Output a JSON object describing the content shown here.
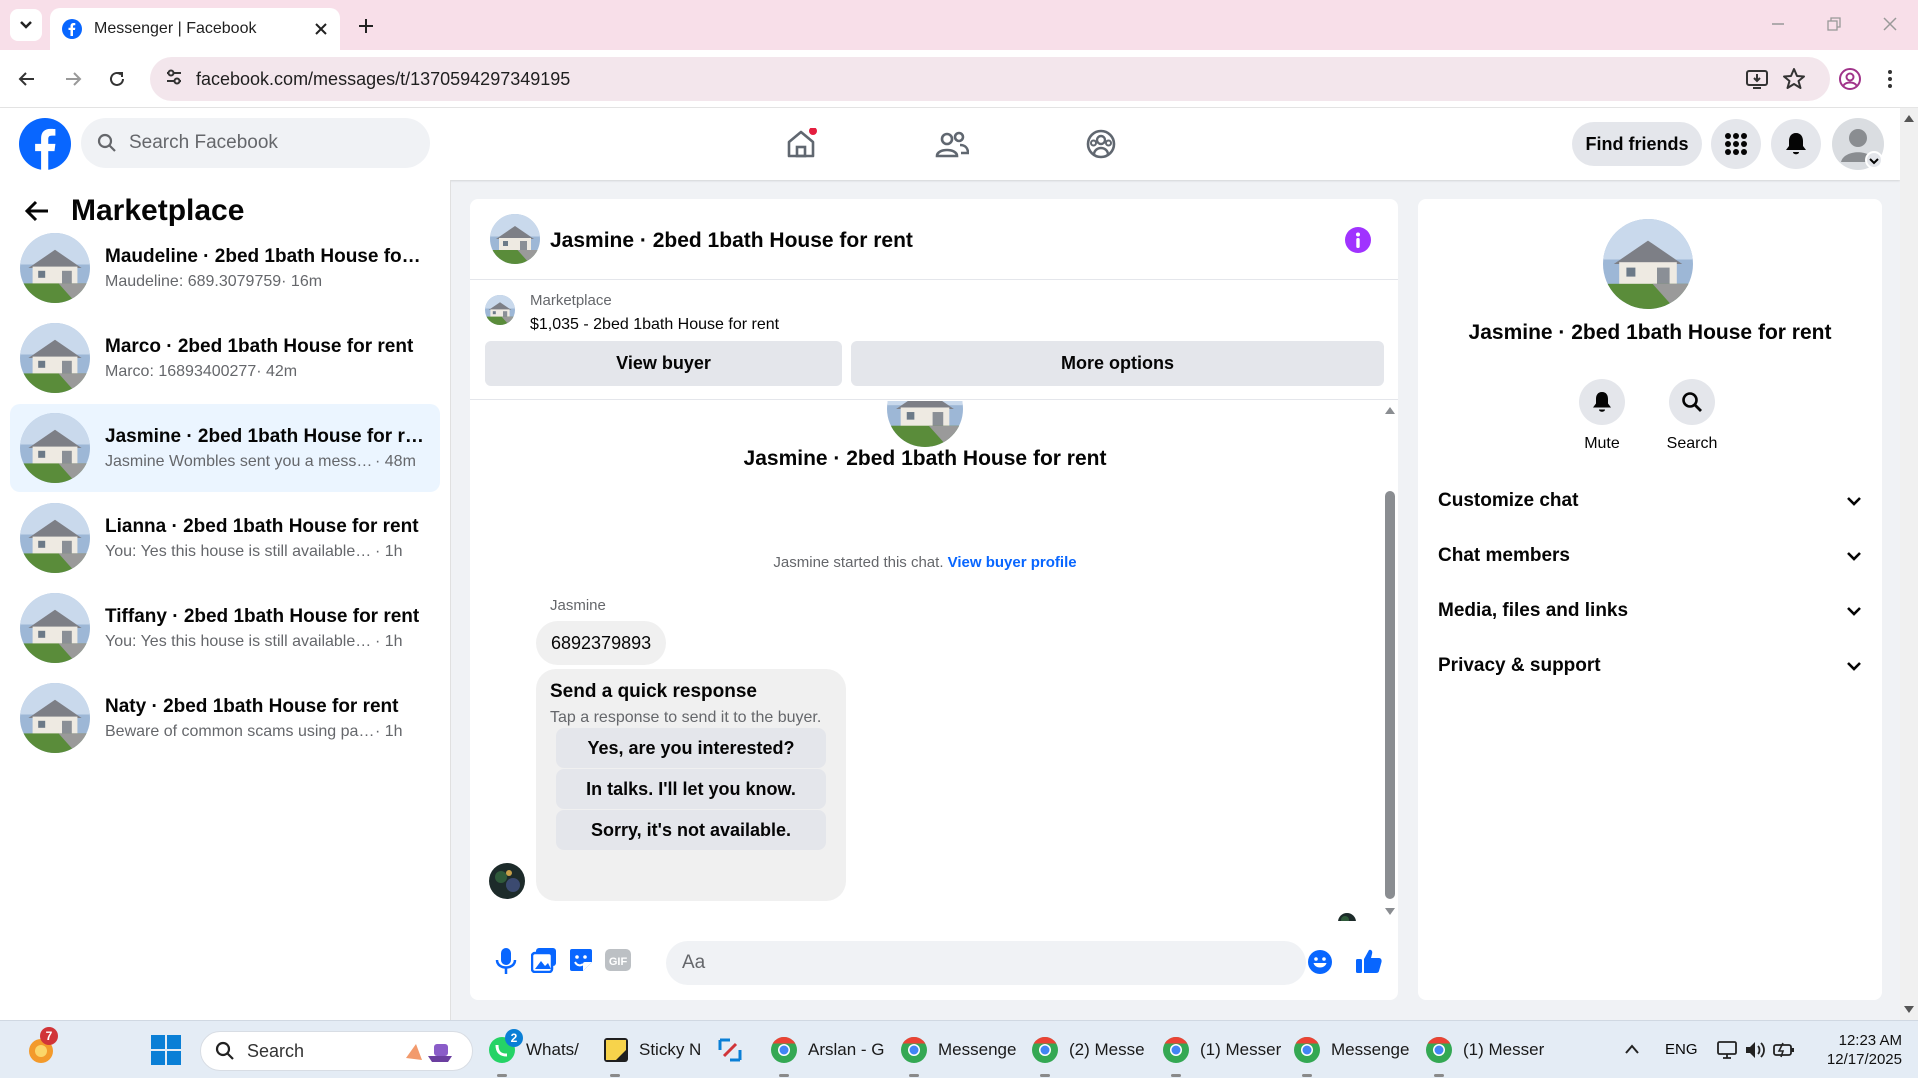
{
  "browser": {
    "tab_title": "Messenger | Facebook",
    "url": "facebook.com/messages/t/1370594297349195"
  },
  "header": {
    "search_placeholder": "Search Facebook",
    "find_friends": "Find friends"
  },
  "marketplace": {
    "title": "Marketplace",
    "conversations": [
      {
        "title": "Maudeline · 2bed 1bath House for ...",
        "preview": "Maudeline: 689.3079759",
        "time": "· 16m",
        "active": false
      },
      {
        "title": "Marco · 2bed 1bath House for rent",
        "preview": "Marco: 16893400277",
        "time": "· 42m",
        "active": false
      },
      {
        "title": "Jasmine · 2bed 1bath House for rent",
        "preview": "Jasmine Wombles sent you a messa...",
        "time": "· 48m",
        "active": true
      },
      {
        "title": "Lianna · 2bed 1bath House for rent",
        "preview": "You: Yes this house is still available for...",
        "time": "· 1h",
        "active": false
      },
      {
        "title": "Tiffany · 2bed 1bath House for rent",
        "preview": "You: Yes this house is still available for...",
        "time": "· 1h",
        "active": false
      },
      {
        "title": "Naty · 2bed 1bath House for rent",
        "preview": "Beware of common scams using pay...",
        "time": "· 1h",
        "active": false
      }
    ]
  },
  "chat": {
    "title": "Jasmine · 2bed 1bath House for rent",
    "listing_label": "Marketplace",
    "listing": "$1,035 - 2bed 1bath House for rent",
    "view_buyer": "View buyer",
    "more_options": "More options",
    "intro_name": "Jasmine · 2bed 1bath House for rent",
    "started_text": "Jasmine started this chat.",
    "view_buyer_profile": "View buyer profile",
    "sender": "Jasmine",
    "message": "6892379893",
    "quick_title": "Send a quick response",
    "quick_sub": "Tap a response to send it to the buyer.",
    "quick_options": [
      "Yes, are you interested?",
      "In talks. I'll let you know.",
      "Sorry, it's not available."
    ],
    "input_placeholder": "Aa"
  },
  "details": {
    "title": "Jasmine · 2bed 1bath House for rent",
    "mute": "Mute",
    "search": "Search",
    "sections": [
      "Customize chat",
      "Chat members",
      "Media, files and links",
      "Privacy & support"
    ]
  },
  "taskbar": {
    "search": "Search",
    "apps": [
      {
        "label": "Whats/",
        "badge": "2"
      },
      {
        "label": "Sticky N"
      },
      {
        "label": "Arslan - G"
      },
      {
        "label": "Messenge"
      },
      {
        "label": "(2) Messe"
      },
      {
        "label": "(1) Messer"
      },
      {
        "label": "Messenge"
      },
      {
        "label": "(1) Messer"
      }
    ],
    "notification_badge": "7",
    "lang": "ENG",
    "time": "12:23 AM",
    "date": "12/17/2025"
  },
  "colors": {
    "fb_blue": "#0866ff",
    "accent_purple": "#a033ff",
    "active_row": "#ebf5ff"
  }
}
